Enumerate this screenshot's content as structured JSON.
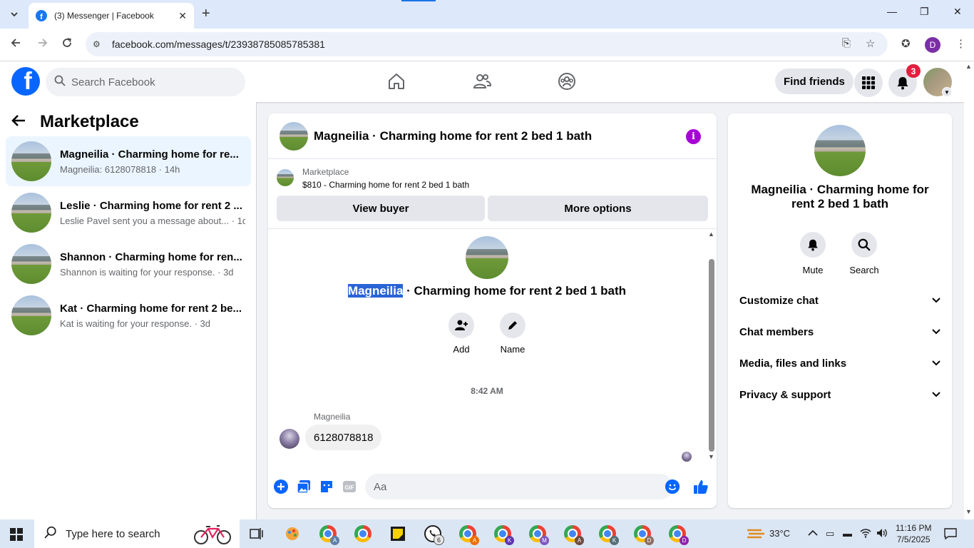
{
  "browser": {
    "tab_title": "(3) Messenger | Facebook",
    "url": "facebook.com/messages/t/23938785085785381"
  },
  "fb_nav": {
    "search_placeholder": "Search Facebook",
    "find_friends": "Find friends",
    "notification_count": "3",
    "brand_color": "#0866ff"
  },
  "sidebar": {
    "title": "Marketplace",
    "conversations": [
      {
        "name": "Magneilia · Charming home for re...",
        "snippet": "Magneilia: 6128078818 · 14h"
      },
      {
        "name": "Leslie · Charming home for rent 2 ...",
        "snippet": "Leslie Pavel sent you a message about... · 1d"
      },
      {
        "name": "Shannon · Charming home for ren...",
        "snippet": "Shannon is waiting for your response. · 3d"
      },
      {
        "name": "Kat · Charming home for rent 2 be...",
        "snippet": "Kat is waiting for your response. · 3d"
      }
    ]
  },
  "chat": {
    "header_title": "Magneilia · Charming home for rent 2 bed 1 bath",
    "marketplace_label": "Marketplace",
    "listing": "$810 - Charming home for rent 2 bed 1 bath",
    "view_buyer": "View buyer",
    "more_options": "More options",
    "title_name": "Magneilia",
    "title_rest": " · Charming home for rent 2 bed 1 bath",
    "add_label": "Add",
    "name_label": "Name",
    "timestamp": "8:42 AM",
    "sender": "Magneilia",
    "message": "6128078818",
    "input_placeholder": "Aa"
  },
  "details": {
    "title": "Magneilia · Charming home for rent 2 bed 1 bath",
    "mute": "Mute",
    "search": "Search",
    "sections": [
      "Customize chat",
      "Chat members",
      "Media, files and links",
      "Privacy & support"
    ]
  },
  "taskbar": {
    "search_placeholder": "Type here to search",
    "whatsapp_badge": "6",
    "chrome_profiles": [
      "A",
      "A",
      "K",
      "M",
      "A",
      "K",
      "D"
    ],
    "temperature": "33°C",
    "time": "11:16 PM",
    "date": "7/5/2025"
  }
}
